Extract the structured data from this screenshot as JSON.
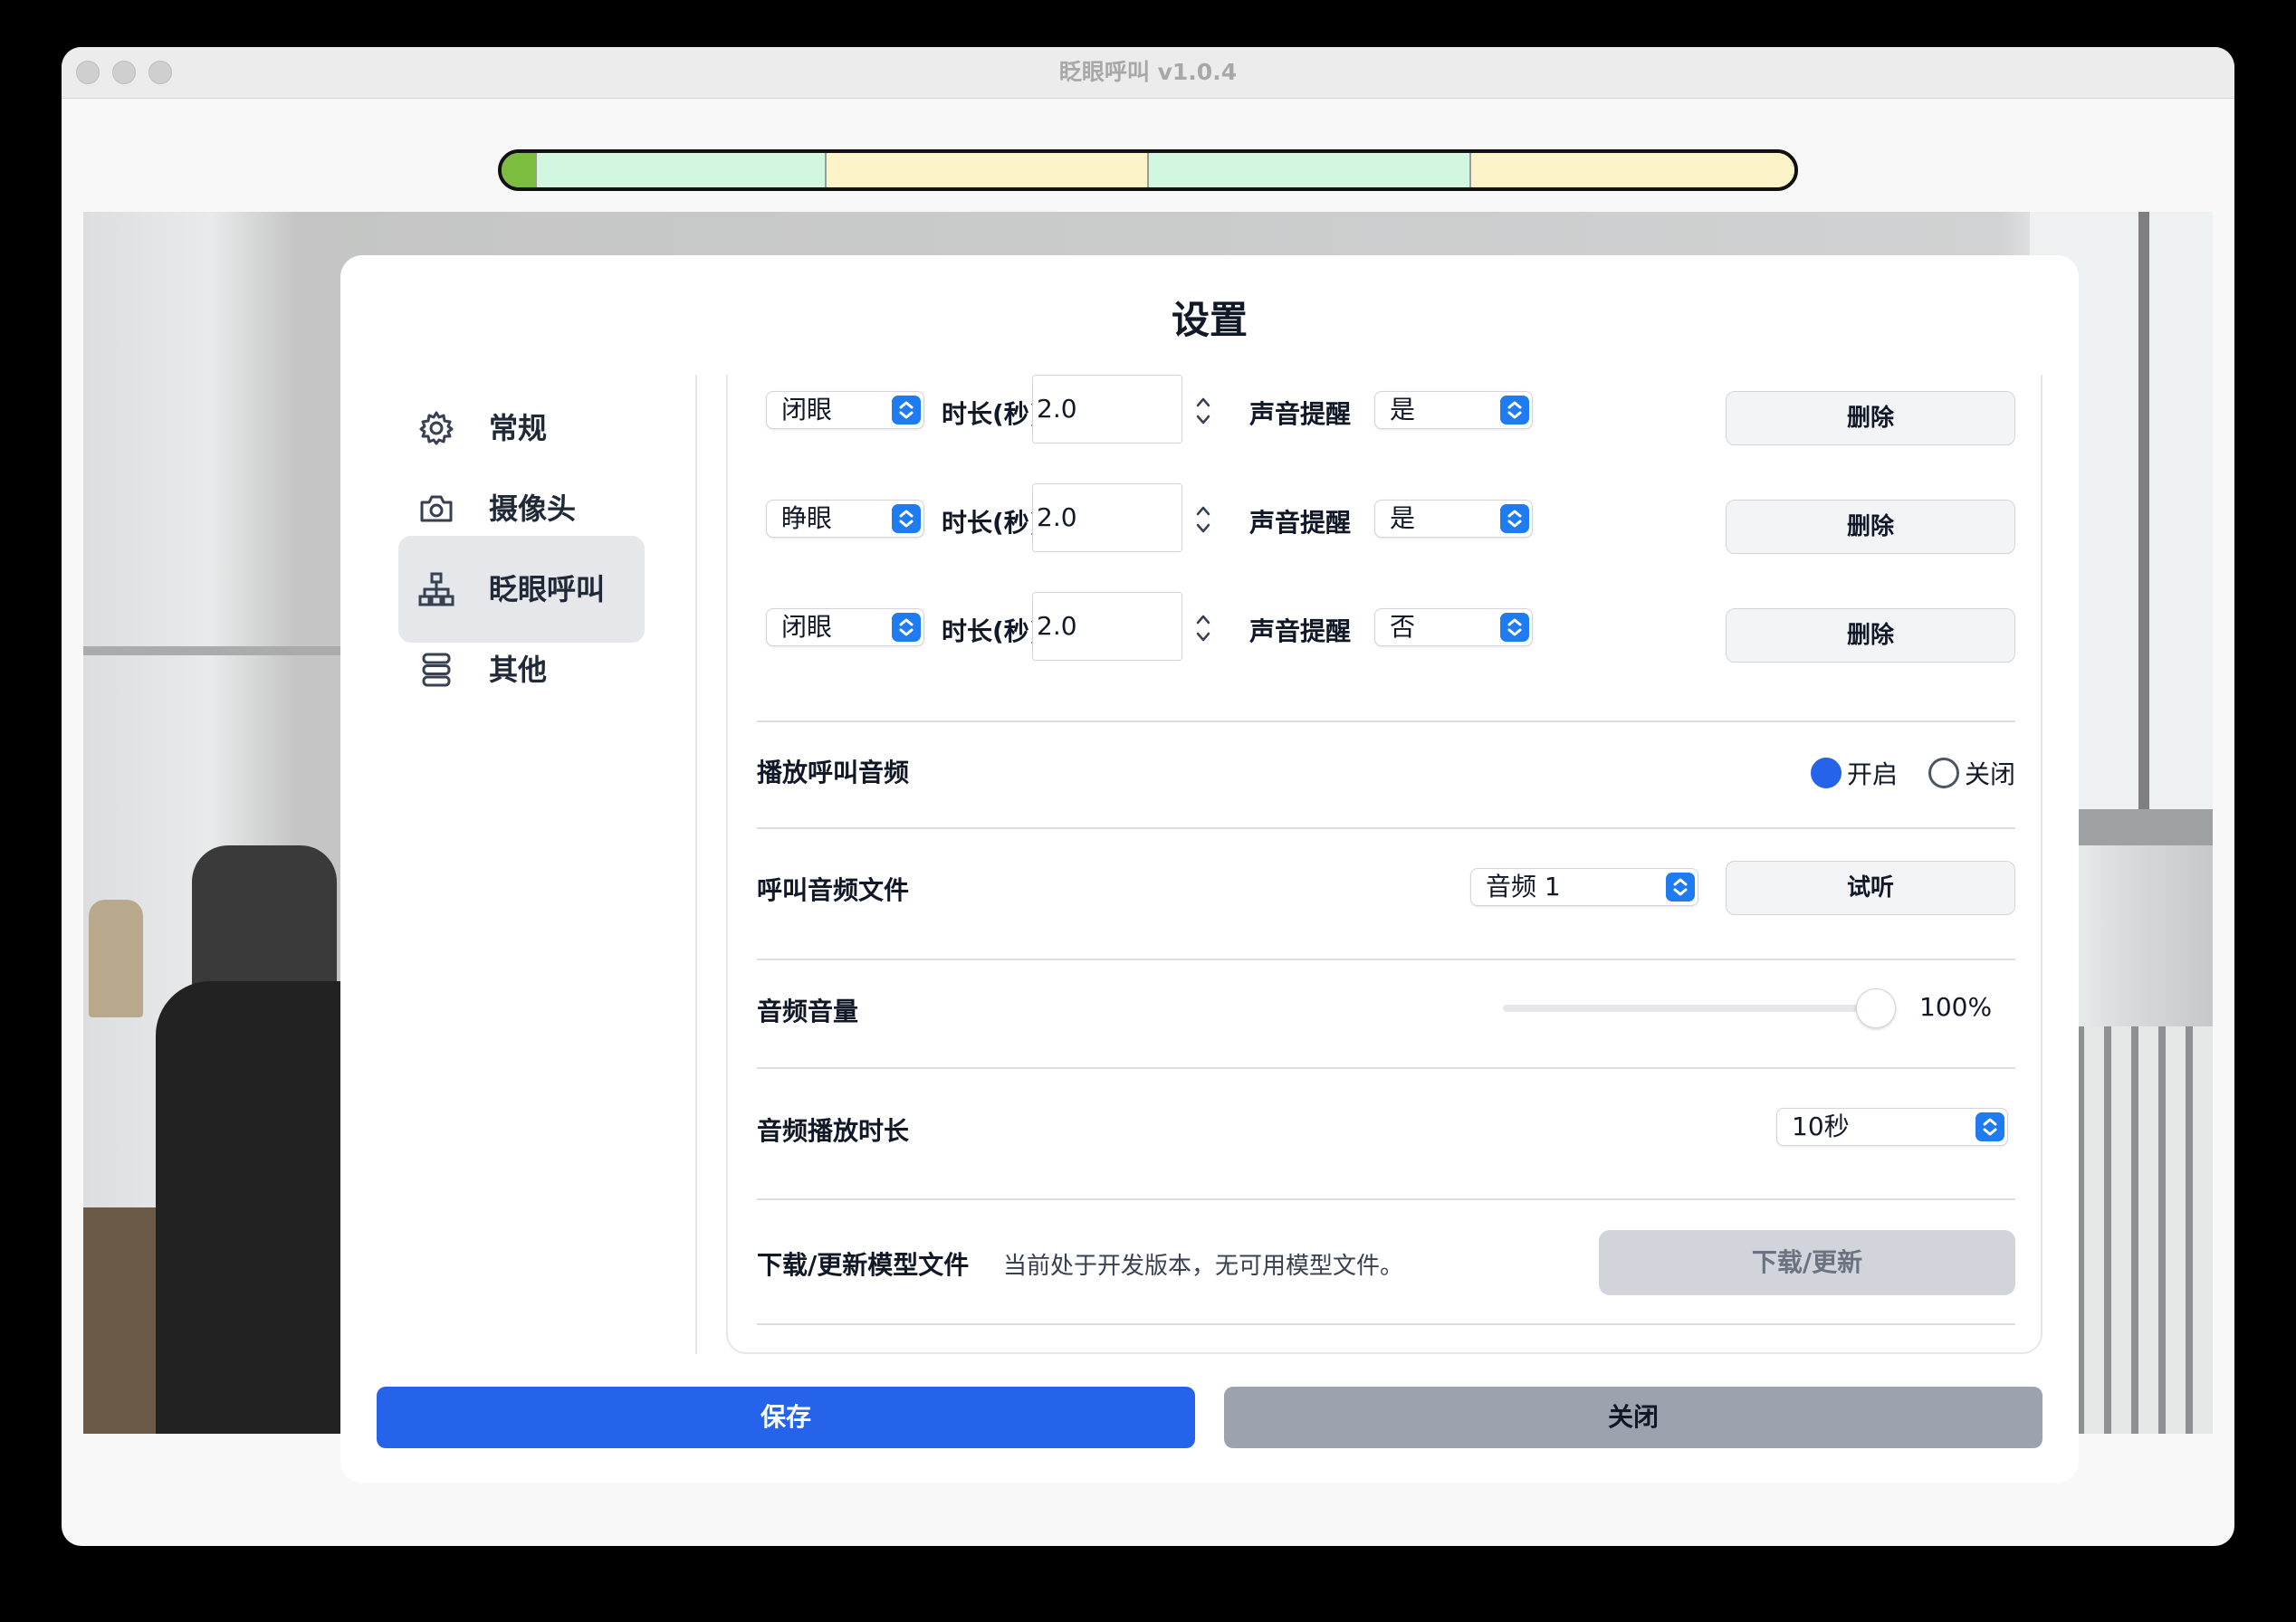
{
  "window": {
    "title": "眨眼呼叫 v1.0.4",
    "traffic_lights": [
      "close-button",
      "minimize-button",
      "zoom-button"
    ]
  },
  "timeline": {
    "segments": [
      {
        "color": "#7cbd3f",
        "fraction": 0.027
      },
      {
        "color": "#d1f7e1",
        "fraction": 0.224
      },
      {
        "color": "#fdf3c9",
        "fraction": 0.249
      },
      {
        "color": "#d1f7e1",
        "fraction": 0.249
      },
      {
        "color": "#fdf3c9",
        "fraction": 0.251
      }
    ]
  },
  "dialog": {
    "title": "设置",
    "sidebar": {
      "items": [
        {
          "label": "常规",
          "icon": "gear-icon",
          "active": false
        },
        {
          "label": "摄像头",
          "icon": "camera-icon",
          "active": false
        },
        {
          "label": "眨眼呼叫",
          "icon": "sitemap-icon",
          "active": true
        },
        {
          "label": "其他",
          "icon": "stack-icon",
          "active": false
        }
      ]
    },
    "sequence": {
      "duration_label": "时长(秒)",
      "sound_label": "声音提醒",
      "delete_label": "删除",
      "rows": [
        {
          "action": "闭眼",
          "duration": "2.0",
          "sound": "是"
        },
        {
          "action": "睁眼",
          "duration": "2.0",
          "sound": "是"
        },
        {
          "action": "闭眼",
          "duration": "2.0",
          "sound": "否"
        }
      ]
    },
    "play_audio": {
      "label": "播放呼叫音频",
      "on_label": "开启",
      "off_label": "关闭",
      "selected": "开启"
    },
    "audio_file": {
      "label": "呼叫音频文件",
      "value": "音频 1",
      "preview_label": "试听"
    },
    "volume": {
      "label": "音频音量",
      "value_text": "100%",
      "fraction": 1.0
    },
    "play_duration": {
      "label": "音频播放时长",
      "value": "10秒"
    },
    "model": {
      "label": "下载/更新模型文件",
      "description": "当前处于开发版本，无可用模型文件。",
      "button_label": "下载/更新"
    },
    "footer": {
      "save_label": "保存",
      "close_label": "关闭"
    }
  },
  "colors": {
    "accent": "#2563eb",
    "select_arrow": "#1e7bf0"
  }
}
